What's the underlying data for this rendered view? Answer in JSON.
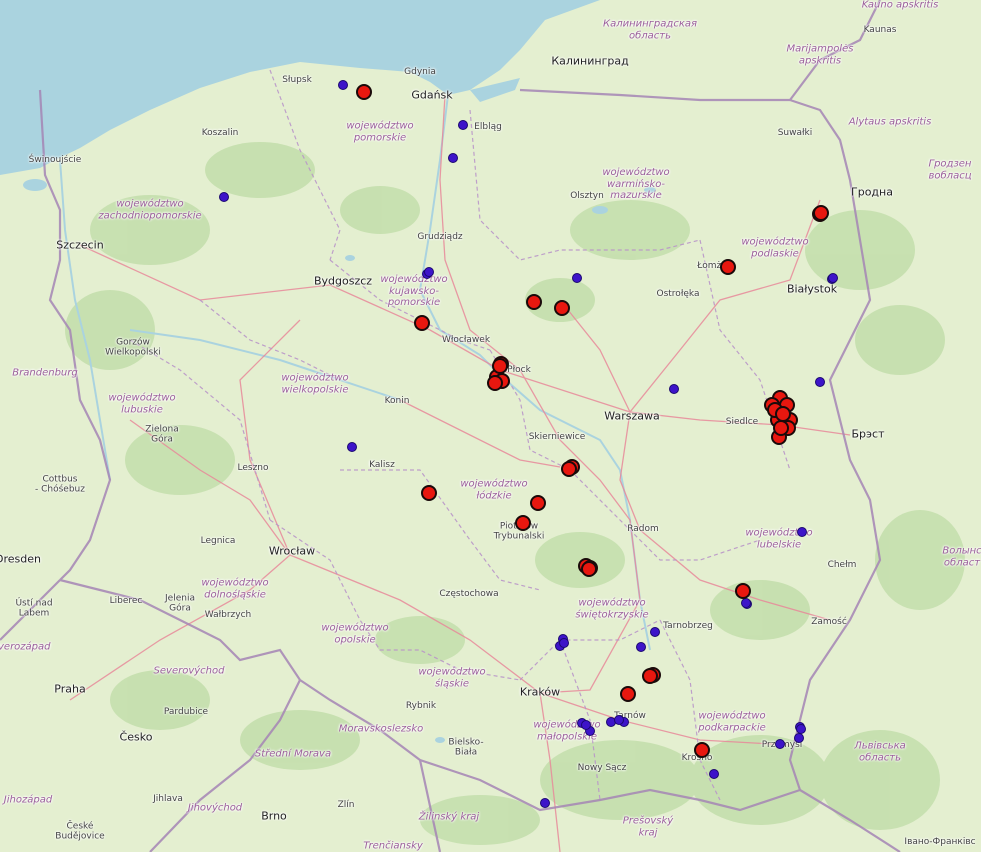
{
  "map": {
    "colors": {
      "land": "#e4efd0",
      "forest": "#b9d9a0",
      "water": "#aad3df",
      "border": "#a585b5",
      "road": "#e8899a",
      "red_marker": "#e8170f",
      "blue_marker": "#3d14c9"
    },
    "labels": [
      {
        "text": "Kauno apskritis",
        "cls": "foreign"
      },
      {
        "text": "Kaunas",
        "cls": "town"
      },
      {
        "text": "Калининградская\nобласть",
        "cls": "foreign"
      },
      {
        "text": "Калининград",
        "cls": "big"
      },
      {
        "text": "Marijampolės\napskritis",
        "cls": "foreign"
      },
      {
        "text": "Alytaus apskritis",
        "cls": "foreign"
      },
      {
        "text": "Suwałki",
        "cls": "town"
      },
      {
        "text": "Гродна",
        "cls": "big"
      },
      {
        "text": "Гродзен\nвобласц",
        "cls": "foreign"
      },
      {
        "text": "Słupsk",
        "cls": "town"
      },
      {
        "text": "Gdynia",
        "cls": "town"
      },
      {
        "text": "Gdańsk",
        "cls": "big"
      },
      {
        "text": "Elbląg",
        "cls": "town"
      },
      {
        "text": "Koszalin",
        "cls": "town"
      },
      {
        "text": "województwo\npomorskie",
        "cls": "region"
      },
      {
        "text": "Świnoujście",
        "cls": "town"
      },
      {
        "text": "województwo\nwarmińsko-\nmazurskie",
        "cls": "region"
      },
      {
        "text": "Olsztyn",
        "cls": "town"
      },
      {
        "text": "województwo\nzachodniopomorskie",
        "cls": "region"
      },
      {
        "text": "Szczecin",
        "cls": "big"
      },
      {
        "text": "Grudziądz",
        "cls": "town"
      },
      {
        "text": "województwo\npodlaskie",
        "cls": "region"
      },
      {
        "text": "Łomża",
        "cls": "town"
      },
      {
        "text": "Białystok",
        "cls": "big"
      },
      {
        "text": "Bydgoszcz",
        "cls": "big"
      },
      {
        "text": "województwo\nkujawsko-\npomorskie",
        "cls": "region"
      },
      {
        "text": "Ostrołęka",
        "cls": "town"
      },
      {
        "text": "Gorzów\nWielkopolski",
        "cls": "town"
      },
      {
        "text": "Włocławek",
        "cls": "town"
      },
      {
        "text": "Płock",
        "cls": "town"
      },
      {
        "text": "Brandenburg",
        "cls": "foreign"
      },
      {
        "text": "województwo\nwielkopolskie",
        "cls": "region"
      },
      {
        "text": "województwo\nlubuskie",
        "cls": "region"
      },
      {
        "text": "Konin",
        "cls": "town"
      },
      {
        "text": "Warszawa",
        "cls": "big"
      },
      {
        "text": "Siedlce",
        "cls": "town"
      },
      {
        "text": "Брэст",
        "cls": "big"
      },
      {
        "text": "Zielona\nGóra",
        "cls": "town"
      },
      {
        "text": "Skierniewice",
        "cls": "town"
      },
      {
        "text": "Leszno",
        "cls": "town"
      },
      {
        "text": "Kalisz",
        "cls": "town"
      },
      {
        "text": "Cottbus\n- Chóśebuz",
        "cls": "town"
      },
      {
        "text": "województwo\nłódzkie",
        "cls": "region"
      },
      {
        "text": "Piotrków\nTrybunalski",
        "cls": "town"
      },
      {
        "text": "Radom",
        "cls": "town"
      },
      {
        "text": "województwo\nlubelskie",
        "cls": "region"
      },
      {
        "text": "Legnica",
        "cls": "town"
      },
      {
        "text": "Wrocław",
        "cls": "big"
      },
      {
        "text": "Dresden",
        "cls": "big"
      },
      {
        "text": "Chełm",
        "cls": "town"
      },
      {
        "text": "Волынс\nобласт",
        "cls": "foreign"
      },
      {
        "text": "województwo\ndolnośląskie",
        "cls": "region"
      },
      {
        "text": "Częstochowa",
        "cls": "town"
      },
      {
        "text": "województwo\nświętokrzyskie",
        "cls": "region"
      },
      {
        "text": "Ústí nad\nLabem",
        "cls": "town"
      },
      {
        "text": "Liberec",
        "cls": "town"
      },
      {
        "text": "Jelenia\nGóra",
        "cls": "town"
      },
      {
        "text": "Wałbrzych",
        "cls": "town"
      },
      {
        "text": "Tarnobrzeg",
        "cls": "town"
      },
      {
        "text": "Zamość",
        "cls": "town"
      },
      {
        "text": "województwo\nopolskie",
        "cls": "region"
      },
      {
        "text": "Severozápad",
        "cls": "foreign"
      },
      {
        "text": "Severovýchod",
        "cls": "foreign"
      },
      {
        "text": "województwo\nśląskie",
        "cls": "region"
      },
      {
        "text": "Praha",
        "cls": "big"
      },
      {
        "text": "Kraków",
        "cls": "big"
      },
      {
        "text": "Rybnik",
        "cls": "town"
      },
      {
        "text": "Pardubice",
        "cls": "town"
      },
      {
        "text": "Tarnów",
        "cls": "town"
      },
      {
        "text": "województwo\npodkarpackie",
        "cls": "region"
      },
      {
        "text": "Moravskoslezsko",
        "cls": "foreign"
      },
      {
        "text": "województwo\nmałopolskie",
        "cls": "region"
      },
      {
        "text": "Bielsko-\nBiała",
        "cls": "town"
      },
      {
        "text": "Przemyśl",
        "cls": "town"
      },
      {
        "text": "Львівська\nобласть",
        "cls": "foreign"
      },
      {
        "text": "Česko",
        "cls": "big"
      },
      {
        "text": "Střední Morava",
        "cls": "foreign"
      },
      {
        "text": "Nowy Sącz",
        "cls": "town"
      },
      {
        "text": "Krosno",
        "cls": "town"
      },
      {
        "text": "Jihozápad",
        "cls": "foreign"
      },
      {
        "text": "Jihlava",
        "cls": "town"
      },
      {
        "text": "Jihovýchod",
        "cls": "foreign"
      },
      {
        "text": "Zlín",
        "cls": "town"
      },
      {
        "text": "Žilinský kraj",
        "cls": "foreign"
      },
      {
        "text": "Prešovský\nkraj",
        "cls": "foreign"
      },
      {
        "text": "Brno",
        "cls": "big"
      },
      {
        "text": "České\nBudějovice",
        "cls": "town"
      },
      {
        "text": "Trenčiansky",
        "cls": "foreign"
      },
      {
        "text": "Івано-Франківс",
        "cls": "town"
      }
    ],
    "red_markers_count": 35,
    "blue_markers_count": 33
  }
}
